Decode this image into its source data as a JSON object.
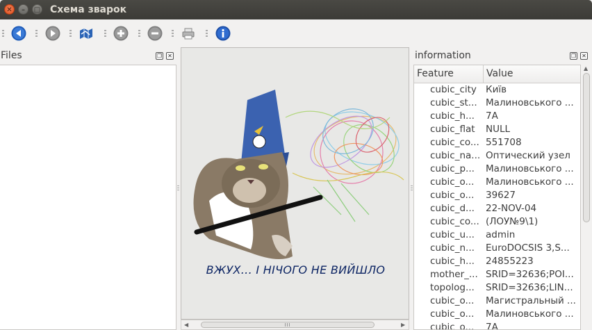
{
  "window": {
    "title": "Схема зварок"
  },
  "toolbar": {
    "buttons": [
      {
        "name": "back",
        "icon": "arrow-left-icon"
      },
      {
        "name": "forward",
        "icon": "play-icon"
      },
      {
        "name": "map",
        "icon": "map-icon"
      },
      {
        "name": "zoom-in",
        "icon": "plus-circle-icon"
      },
      {
        "name": "zoom-out",
        "icon": "minus-circle-icon"
      },
      {
        "name": "print",
        "icon": "printer-icon"
      },
      {
        "name": "info",
        "icon": "info-icon"
      }
    ]
  },
  "files_panel": {
    "title": "Files"
  },
  "view": {
    "caption": "ВЖУХ... І НІЧОГО НЕ ВИЙШЛО"
  },
  "info_panel": {
    "title": "information",
    "columns": [
      "Feature",
      "Value"
    ],
    "rows": [
      {
        "feature": "cubic_city",
        "value": "Київ"
      },
      {
        "feature": "cubic_st...",
        "value": "Малиновського ..."
      },
      {
        "feature": "cubic_h...",
        "value": "7А"
      },
      {
        "feature": "cubic_flat",
        "value": "NULL"
      },
      {
        "feature": "cubic_co...",
        "value": "551708"
      },
      {
        "feature": "cubic_na...",
        "value": "Оптический узел"
      },
      {
        "feature": "cubic_p...",
        "value": "Малиновського ..."
      },
      {
        "feature": "cubic_o...",
        "value": "Малиновського ..."
      },
      {
        "feature": "cubic_o...",
        "value": "39627"
      },
      {
        "feature": "cubic_d...",
        "value": "22-NOV-04"
      },
      {
        "feature": "cubic_co...",
        "value": "(ЛОУ№9\\1)"
      },
      {
        "feature": "cubic_u...",
        "value": "admin"
      },
      {
        "feature": "cubic_n...",
        "value": "EuroDOCSIS 3,S..."
      },
      {
        "feature": "cubic_h...",
        "value": "24855223"
      },
      {
        "feature": "mother_...",
        "value": "SRID=32636;POI..."
      },
      {
        "feature": "topolog...",
        "value": "SRID=32636;LIN..."
      },
      {
        "feature": "cubic_o...",
        "value": "Магистральный ..."
      },
      {
        "feature": "cubic_o...",
        "value": "Малиновського ..."
      },
      {
        "feature": "cubic_o...",
        "value": "7А"
      }
    ]
  },
  "colors": {
    "titlebar": "#3c3b37",
    "close": "#e0501c",
    "caption": "#0c2463",
    "toolbar_icon": "#1e5bb8"
  }
}
